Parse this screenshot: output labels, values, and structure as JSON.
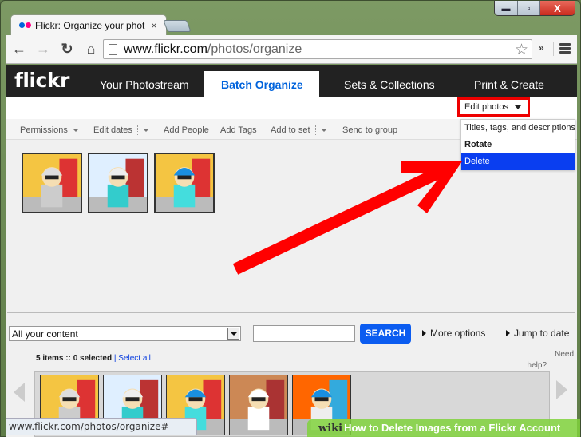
{
  "browser": {
    "tab_title": "Flickr: Organize your phot",
    "tab_close": "×",
    "url_host": "www.flickr.com",
    "url_path": "/photos/organize",
    "back_icon": "←",
    "forward_icon": "→",
    "reload_icon": "↻",
    "home_icon": "⌂",
    "star_icon": "☆",
    "extensions_icon": "»",
    "window_controls": {
      "minimize": "▬",
      "maximize": "▫",
      "close": "X"
    }
  },
  "flickr": {
    "logo": "flickr",
    "nav": [
      {
        "label": "Your Photostream"
      },
      {
        "label": "Batch Organize",
        "active": true
      },
      {
        "label": "Sets & Collections"
      },
      {
        "label": "Print & Create"
      }
    ],
    "actions": [
      {
        "label": "Permissions"
      },
      {
        "label": "Edit dates"
      },
      {
        "label": "Add People"
      },
      {
        "label": "Add Tags"
      },
      {
        "label": "Add to set"
      },
      {
        "label": "Send to group"
      }
    ],
    "edit_photos": {
      "label": "Edit photos",
      "menu": [
        {
          "label": "Titles, tags, and descriptions"
        },
        {
          "label": "Rotate"
        },
        {
          "label": "Delete",
          "highlighted": true
        }
      ]
    },
    "batch_photos_count": 3,
    "filter": {
      "select_value": "All your content",
      "search_value": "",
      "search_label": "SEARCH",
      "more_options": "More options",
      "jump_to_date": "Jump to date"
    },
    "status": {
      "items": "5 items",
      "separator": "::",
      "selected": "0 selected",
      "pipe": "|",
      "select_all": "Select all"
    },
    "need_help_1": "Need",
    "need_help_2": "help?",
    "strip_photos_count": 5
  },
  "status_url": "www.flickr.com/photos/organize#",
  "banner": {
    "wiki": "wiki",
    "title": "How to Delete Images from a Flickr Account"
  },
  "colors": {
    "flickr_blue": "#0063dc",
    "highlight_red": "#ee0000",
    "delete_highlight": "#0a3ef0",
    "search_button": "#0b5cf0"
  }
}
